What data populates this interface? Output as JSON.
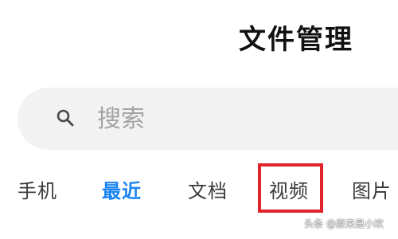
{
  "header": {
    "title": "文件管理"
  },
  "search": {
    "placeholder": "搜索",
    "icon": "search-icon"
  },
  "tabs": [
    {
      "label": "手机",
      "active": false
    },
    {
      "label": "最近",
      "active": true
    },
    {
      "label": "文档",
      "active": false
    },
    {
      "label": "视频",
      "active": false
    },
    {
      "label": "图片",
      "active": false
    }
  ],
  "annotation": {
    "highlight_color": "#e0242b",
    "highlighted_tab": "视频"
  },
  "watermark": {
    "text": "头条 @原来是小欢"
  },
  "colors": {
    "accent": "#1a84f0",
    "search_background": "#f2f2f2",
    "text": "#111111"
  }
}
